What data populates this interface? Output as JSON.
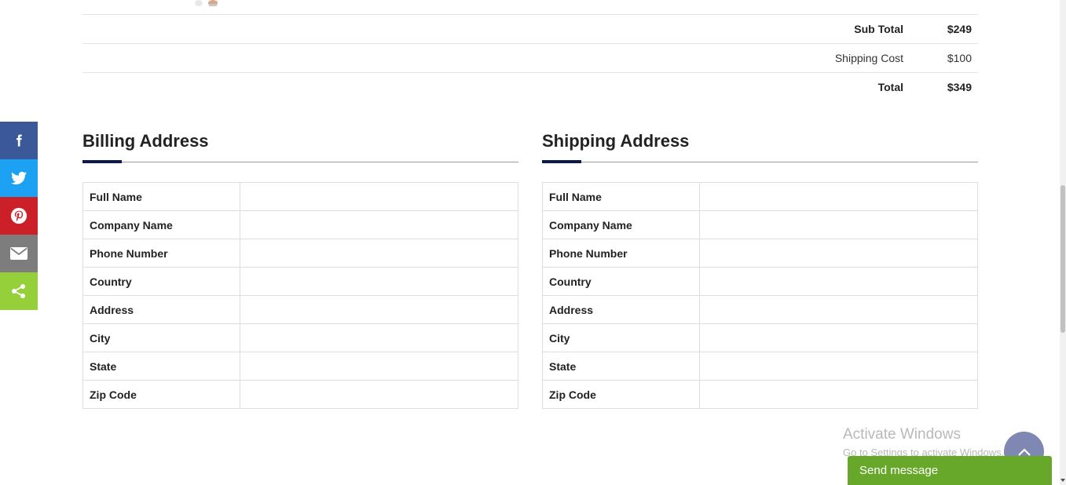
{
  "summary": {
    "sub_total_label": "Sub Total",
    "sub_total_value": "$249",
    "shipping_label": "Shipping Cost",
    "shipping_value": "$100",
    "total_label": "Total",
    "total_value": "$349"
  },
  "billing": {
    "title": "Billing Address",
    "fields": [
      "Full Name",
      "Company Name",
      "Phone Number",
      "Country",
      "Address",
      "City",
      "State",
      "Zip Code"
    ],
    "values": [
      "",
      "",
      "",
      "",
      "",
      "",
      "",
      ""
    ]
  },
  "shipping": {
    "title": "Shipping Address",
    "fields": [
      "Full Name",
      "Company Name",
      "Phone Number",
      "Country",
      "Address",
      "City",
      "State",
      "Zip Code"
    ],
    "values": [
      "",
      "",
      "",
      "",
      "",
      "",
      "",
      ""
    ]
  },
  "share": {
    "icons": [
      "facebook-icon",
      "twitter-icon",
      "pinterest-icon",
      "email-icon",
      "share-icon"
    ]
  },
  "watermark": {
    "line1": "Activate Windows",
    "line2": "Go to Settings to activate Windows."
  },
  "chat": {
    "label": "Send message"
  },
  "colors": {
    "facebook": "#3b5998",
    "twitter": "#1da1f2",
    "pinterest": "#cb2027",
    "email": "#7d7d7d",
    "share": "#95d03a",
    "accent": "#0f1a4a",
    "chat": "#67a82a",
    "scroll_top": "#7f87b3"
  }
}
